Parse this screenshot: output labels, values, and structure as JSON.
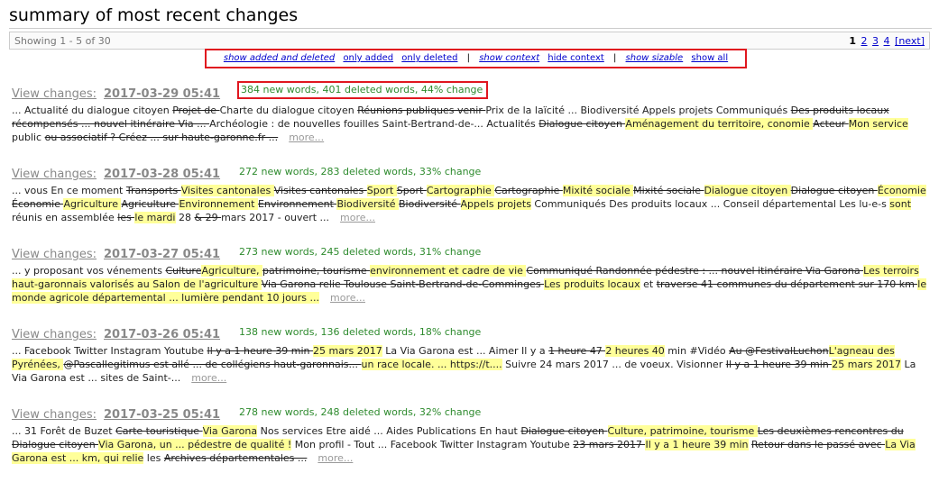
{
  "page": {
    "title": "summary of most recent changes"
  },
  "bar": {
    "showing": "Showing 1 - 5 of 30",
    "pages": [
      "1",
      "2",
      "3",
      "4"
    ],
    "next": "[next]"
  },
  "filters": {
    "show_added_deleted": "show added and deleted",
    "only_added": "only added",
    "only_deleted": "only deleted",
    "sep": "|",
    "show_context": "show context",
    "hide_context": "hide context",
    "show_sizable": "show sizable",
    "show_all": "show all"
  },
  "entries": [
    {
      "link": "View changes:",
      "date": "2017-03-29 05:41",
      "stats": "384 new words, 401 deleted words, 44% change",
      "more": "more...",
      "segments": [
        {
          "t": "... Actualité du dialogue citoyen ",
          "k": "n"
        },
        {
          "t": "Projet de ",
          "k": "d"
        },
        {
          "t": "Charte du dialogue citoyen ",
          "k": "n"
        },
        {
          "t": "Réunions publiques venir ",
          "k": "d"
        },
        {
          "t": "Prix de la laïcité ... Biodiversité Appels projets Communiqués ",
          "k": "n"
        },
        {
          "t": "Des produits locaux récompensés ... nouvel itinéraire Via ... ",
          "k": "d"
        },
        {
          "t": "Archéologie : de nouvelles fouilles Saint-Bertrand-de-... Actualités ",
          "k": "n"
        },
        {
          "t": "Dialogue citoyen ",
          "k": "d"
        },
        {
          "t": "Aménagement du territoire, conomie ",
          "k": "i"
        },
        {
          "t": "Acteur ",
          "k": "d"
        },
        {
          "t": "Mon service",
          "k": "i"
        },
        {
          "t": " public ",
          "k": "n"
        },
        {
          "t": "ou associatif ? Créez ... sur haute-garonne.fr ...",
          "k": "d"
        }
      ]
    },
    {
      "link": "View changes:",
      "date": "2017-03-28 05:41",
      "stats": "272 new words, 283 deleted words, 33% change",
      "more": "more...",
      "segments": [
        {
          "t": "... vous En ce moment ",
          "k": "n"
        },
        {
          "t": "Transports ",
          "k": "d"
        },
        {
          "t": "Visites cantonales ",
          "k": "i"
        },
        {
          "t": "Visites cantonales ",
          "k": "d"
        },
        {
          "t": "Sport ",
          "k": "i"
        },
        {
          "t": "Sport ",
          "k": "d"
        },
        {
          "t": "Cartographie ",
          "k": "i"
        },
        {
          "t": "Cartographie ",
          "k": "d"
        },
        {
          "t": "Mixité sociale ",
          "k": "i"
        },
        {
          "t": "Mixité sociale ",
          "k": "d"
        },
        {
          "t": "Dialogue citoyen ",
          "k": "i"
        },
        {
          "t": "Dialogue citoyen ",
          "k": "d"
        },
        {
          "t": "Économie ",
          "k": "i"
        },
        {
          "t": "Économie ",
          "k": "d"
        },
        {
          "t": "Agriculture ",
          "k": "i"
        },
        {
          "t": "Agriculture ",
          "k": "d"
        },
        {
          "t": "Environnement ",
          "k": "i"
        },
        {
          "t": "Environnement ",
          "k": "d"
        },
        {
          "t": "Biodiversité ",
          "k": "i"
        },
        {
          "t": "Biodiversité ",
          "k": "d"
        },
        {
          "t": "Appels projets",
          "k": "i"
        },
        {
          "t": " Communiqués Des produits locaux ... Conseil départemental Les lu-e-s ",
          "k": "n"
        },
        {
          "t": "sont",
          "k": "i"
        },
        {
          "t": " réunis en assemblée ",
          "k": "n"
        },
        {
          "t": "les ",
          "k": "d"
        },
        {
          "t": "le mardi",
          "k": "i"
        },
        {
          "t": " 28 ",
          "k": "n"
        },
        {
          "t": "& 29 ",
          "k": "d"
        },
        {
          "t": "mars 2017 - ouvert ...",
          "k": "n"
        }
      ]
    },
    {
      "link": "View changes:",
      "date": "2017-03-27 05:41",
      "stats": "273 new words, 245 deleted words, 31% change",
      "more": "more...",
      "segments": [
        {
          "t": "... y proposant vos vénements ",
          "k": "n"
        },
        {
          "t": "Culture",
          "k": "d"
        },
        {
          "t": "Agriculture, ",
          "k": "i"
        },
        {
          "t": "patrimoine, tourisme ",
          "k": "d"
        },
        {
          "t": "environnement et cadre de vie ",
          "k": "i"
        },
        {
          "t": "Communiqué Randonnée pédestre : ... nouvel itinéraire Via Garona ",
          "k": "d"
        },
        {
          "t": "Les terroirs haut-garonnais valorisés au Salon de l'agriculture ",
          "k": "i"
        },
        {
          "t": "Via Garona relie Toulouse Saint-Bertrand-de-Comminges ",
          "k": "d"
        },
        {
          "t": "Les produits locaux",
          "k": "i"
        },
        {
          "t": " et ",
          "k": "n"
        },
        {
          "t": "traverse 41 communes du département sur 170 km ",
          "k": "d"
        },
        {
          "t": "le monde agricole départemental ... lumière pendant 10 jours ...",
          "k": "i"
        }
      ]
    },
    {
      "link": "View changes:",
      "date": "2017-03-26 05:41",
      "stats": "138 new words, 136 deleted words, 18% change",
      "more": "more...",
      "segments": [
        {
          "t": "... Facebook Twitter Instagram Youtube ",
          "k": "n"
        },
        {
          "t": "Il y a 1 heure 39 min ",
          "k": "d"
        },
        {
          "t": "25 mars 2017",
          "k": "i"
        },
        {
          "t": " La Via Garona est ... Aimer Il y a ",
          "k": "n"
        },
        {
          "t": "1 heure 47 ",
          "k": "d"
        },
        {
          "t": "2 heures 40",
          "k": "i"
        },
        {
          "t": " min #Vidéo ",
          "k": "n"
        },
        {
          "t": "Au @FestivalLuchon",
          "k": "d"
        },
        {
          "t": "L'agneau des Pyrénées, ",
          "k": "i"
        },
        {
          "t": "@Pascallegitimus est allé ... de collégiens haut-garonnais... ",
          "k": "d"
        },
        {
          "t": "un race locale. ... https://t....",
          "k": "i"
        },
        {
          "t": " Suivre 24 mars 2017 ... de voeux. Visionner ",
          "k": "n"
        },
        {
          "t": "Il y a 1 heure 39 min ",
          "k": "d"
        },
        {
          "t": "25 mars 2017",
          "k": "i"
        },
        {
          "t": " La Via Garona est ... sites de Saint-...",
          "k": "n"
        }
      ]
    },
    {
      "link": "View changes:",
      "date": "2017-03-25 05:41",
      "stats": "278 new words, 248 deleted words, 32% change",
      "more": "more...",
      "segments": [
        {
          "t": "... 31 Forêt de Buzet ",
          "k": "n"
        },
        {
          "t": "Carte touristique ",
          "k": "d"
        },
        {
          "t": "Via Garona",
          "k": "i"
        },
        {
          "t": " Nos services Etre aidé ... Aides Publications En haut ",
          "k": "n"
        },
        {
          "t": "Dialogue citoyen ",
          "k": "d"
        },
        {
          "t": "Culture, patrimoine, tourisme ",
          "k": "i"
        },
        {
          "t": "Les deuxièmes rencontres du Dialogue citoyen ",
          "k": "d"
        },
        {
          "t": "Via Garona, un ... pédestre de qualité !",
          "k": "i"
        },
        {
          "t": " Mon profil - Tout ... Facebook Twitter Instagram Youtube ",
          "k": "n"
        },
        {
          "t": "23 mars 2017 ",
          "k": "d"
        },
        {
          "t": "Il y a 1 heure 39 min",
          "k": "i"
        },
        {
          "t": " ",
          "k": "n"
        },
        {
          "t": "Retour dans le passé avec ",
          "k": "d"
        },
        {
          "t": "La Via Garona est ... km, qui relie",
          "k": "i"
        },
        {
          "t": " les ",
          "k": "n"
        },
        {
          "t": "Archives départementales ...",
          "k": "d"
        }
      ]
    }
  ]
}
